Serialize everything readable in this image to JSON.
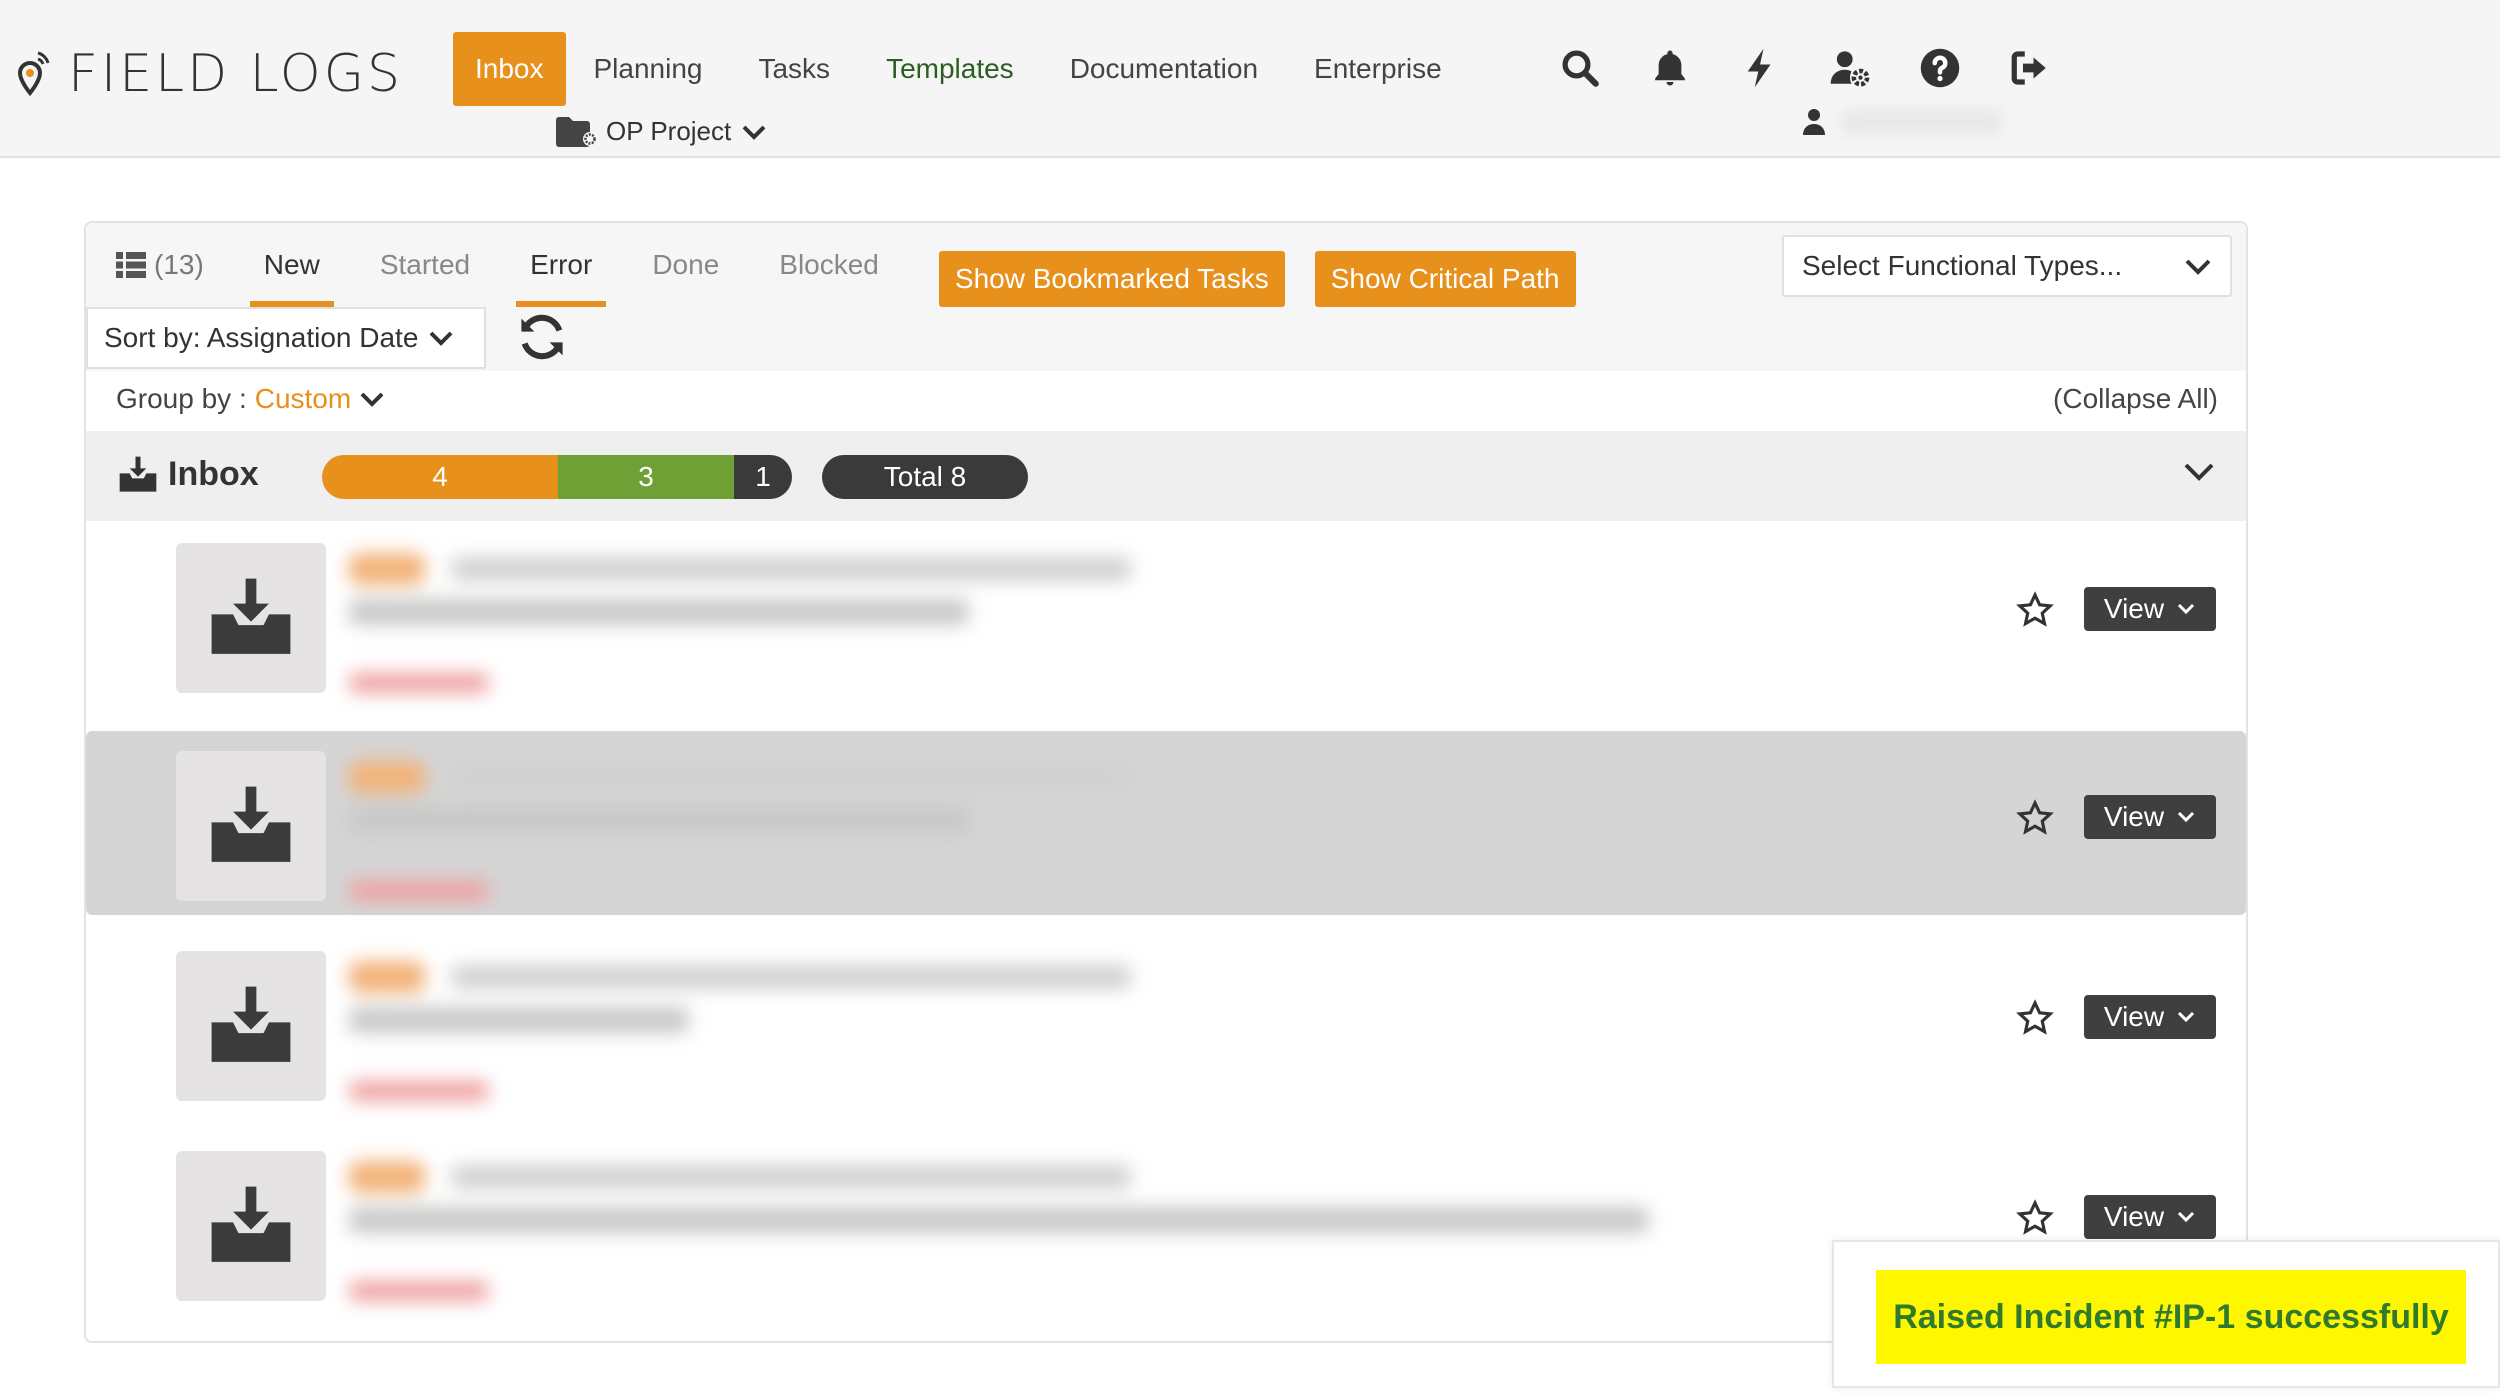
{
  "app": {
    "name": "FIELD LOGS"
  },
  "nav": {
    "items": [
      {
        "label": "Inbox",
        "active": true
      },
      {
        "label": "Planning"
      },
      {
        "label": "Tasks"
      },
      {
        "label": "Templates"
      },
      {
        "label": "Documentation"
      },
      {
        "label": "Enterprise"
      }
    ],
    "icons": [
      "search-icon",
      "bell-icon",
      "bolt-icon",
      "user-settings-icon",
      "help-icon",
      "logout-icon"
    ],
    "project": "OP Project"
  },
  "filters": {
    "count": "(13)",
    "tabs": [
      "New",
      "Started",
      "Error",
      "Done",
      "Blocked"
    ],
    "show_bookmarked": "Show Bookmarked Tasks",
    "show_critical": "Show Critical Path",
    "functional_types_placeholder": "Select Functional Types...",
    "sort_by": "Sort by: Assignation Date",
    "group_by_label": "Group by :",
    "group_by_value": "Custom",
    "collapse_all": "(Collapse All)"
  },
  "group": {
    "title": "Inbox",
    "segments": [
      {
        "value": "4",
        "color": "#e8901c"
      },
      {
        "value": "3",
        "color": "#6fa035"
      },
      {
        "value": "1",
        "color": "#3a3a3a"
      }
    ],
    "total": "Total 8"
  },
  "tasks": [
    {
      "view_label": "View"
    },
    {
      "view_label": "View"
    },
    {
      "view_label": "View"
    },
    {
      "view_label": "View"
    }
  ],
  "toast": {
    "message": "Raised Incident #IP-1 successfully"
  },
  "colors": {
    "accent": "#e8901c",
    "green": "#6fa035",
    "dark": "#3a3a3a",
    "toast_bg": "#fff700",
    "toast_text": "#2e7a2e"
  }
}
